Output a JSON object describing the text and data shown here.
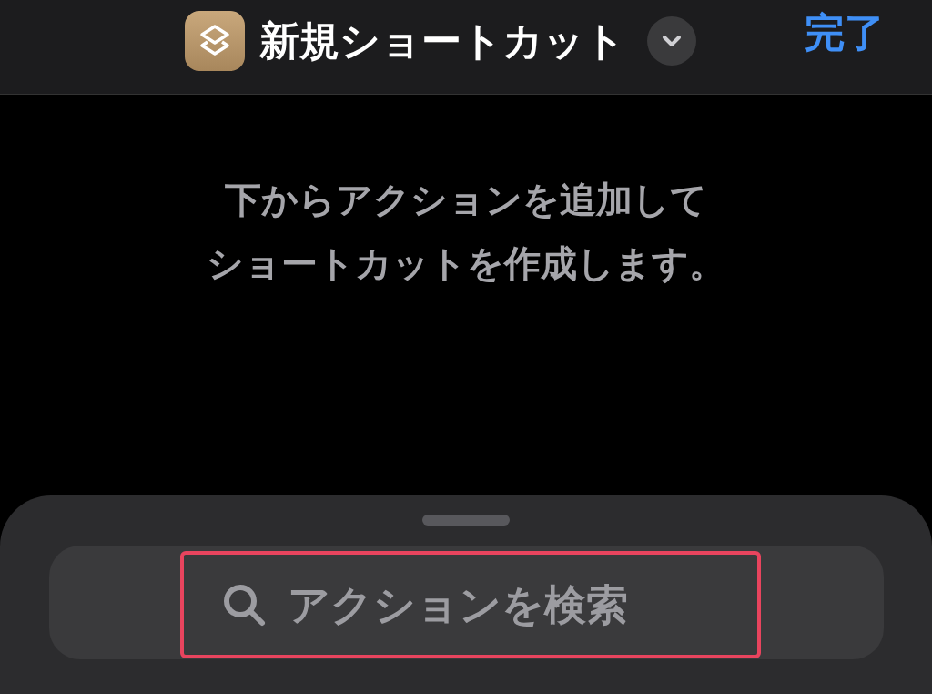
{
  "header": {
    "title": "新規ショートカット",
    "done": "完了"
  },
  "message": [
    "下からアクションを追加して",
    "ショートカットを作成します。"
  ],
  "search": {
    "placeholder": "アクションを検索",
    "highlighted": true
  }
}
